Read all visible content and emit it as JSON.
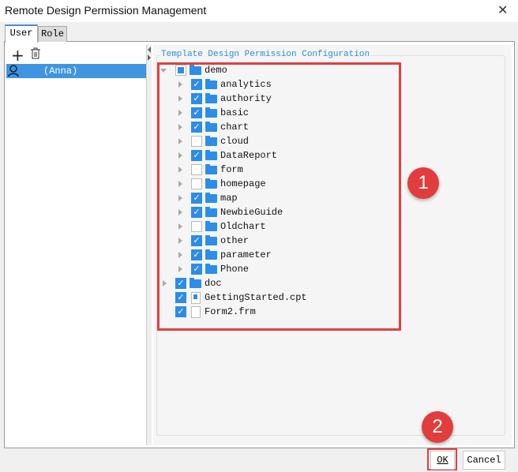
{
  "window": {
    "title": "Remote Design Permission Management",
    "close": "✕"
  },
  "tabs": [
    {
      "label": "User"
    },
    {
      "label": "Role"
    }
  ],
  "left": {
    "add": "+",
    "users": [
      {
        "name": "(Anna)"
      }
    ]
  },
  "config": {
    "title": "Template Design Permission Configuration",
    "tree": [
      {
        "label": "demo",
        "level": 0,
        "state": "partial",
        "type": "folder",
        "expanded": true
      },
      {
        "label": "analytics",
        "level": 1,
        "state": "checked",
        "type": "folder"
      },
      {
        "label": "authority",
        "level": 1,
        "state": "checked",
        "type": "folder"
      },
      {
        "label": "basic",
        "level": 1,
        "state": "checked",
        "type": "folder"
      },
      {
        "label": "chart",
        "level": 1,
        "state": "checked",
        "type": "folder"
      },
      {
        "label": "cloud",
        "level": 1,
        "state": "unchecked",
        "type": "folder"
      },
      {
        "label": "DataReport",
        "level": 1,
        "state": "checked",
        "type": "folder"
      },
      {
        "label": "form",
        "level": 1,
        "state": "unchecked",
        "type": "folder"
      },
      {
        "label": "homepage",
        "level": 1,
        "state": "unchecked",
        "type": "folder"
      },
      {
        "label": "map",
        "level": 1,
        "state": "checked",
        "type": "folder"
      },
      {
        "label": "NewbieGuide",
        "level": 1,
        "state": "checked",
        "type": "folder"
      },
      {
        "label": "Oldchart",
        "level": 1,
        "state": "unchecked",
        "type": "folder"
      },
      {
        "label": "other",
        "level": 1,
        "state": "checked",
        "type": "folder"
      },
      {
        "label": "parameter",
        "level": 1,
        "state": "checked",
        "type": "folder"
      },
      {
        "label": "Phone",
        "level": 1,
        "state": "checked",
        "type": "folder"
      },
      {
        "label": "doc",
        "level": 0,
        "state": "checked",
        "type": "folder"
      },
      {
        "label": "GettingStarted.cpt",
        "level": 0,
        "state": "checked",
        "type": "cpt"
      },
      {
        "label": "Form2.frm",
        "level": 0,
        "state": "checked",
        "type": "frm"
      }
    ]
  },
  "annotations": [
    "1",
    "2"
  ],
  "buttons": {
    "ok": "OK",
    "cancel": "Cancel"
  }
}
